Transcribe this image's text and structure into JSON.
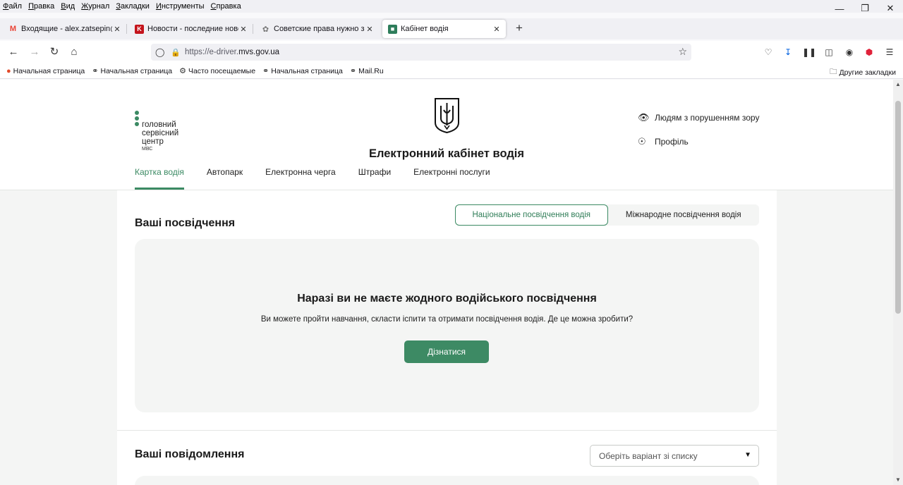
{
  "browser": {
    "menu": [
      "Файл",
      "Правка",
      "Вид",
      "Журнал",
      "Закладки",
      "Инструменты",
      "Справка"
    ],
    "tabs": [
      {
        "title": "Входящие - alex.zatsepin@ciph",
        "icon": "gmail-icon",
        "color": "#ea4335"
      },
      {
        "title": "Новости - последние новости",
        "icon": "news-k-icon",
        "color": "#c4141c"
      },
      {
        "title": "Советские права нужно замен",
        "icon": "spinner-icon",
        "color": "#777777"
      },
      {
        "title": "Кабінет водія",
        "icon": "car-icon",
        "color": "#2e7d5b"
      }
    ],
    "url_prefix": "https://e-driver.",
    "url_domain": "mvs.gov.ua",
    "bookmarks": [
      "Начальная страница",
      "Начальная страница",
      "Часто посещаемые",
      "Начальная страница",
      "Mail.Ru"
    ],
    "other_bookmarks": "Другие закладки"
  },
  "site": {
    "logo_lines": [
      "головний",
      "сервісний",
      "центр"
    ],
    "logo_sub": "МВС",
    "title": "Електронний кабінет водія",
    "accessibility_link": "Людям з порушенням зору",
    "profile_link": "Профіль",
    "nav": [
      "Картка водія",
      "Автопарк",
      "Електронна черга",
      "Штрафи",
      "Електронні послуги"
    ],
    "accent": "#3b8a63"
  },
  "licenses": {
    "title": "Ваші посвідчення",
    "toggle": [
      "Національне посвідчення водія",
      "Міжнародне посвідчення водія"
    ],
    "empty_title": "Наразі ви не маєте жодного водійського посвідчення",
    "empty_text": "Ви можете пройти навчання, скласти іспити та отримати посвідчення водія. Де це можна зробити?",
    "button": "Дізнатися"
  },
  "messages": {
    "title": "Ваші повідомлення",
    "select_placeholder": "Оберіть варіант зі списку"
  }
}
